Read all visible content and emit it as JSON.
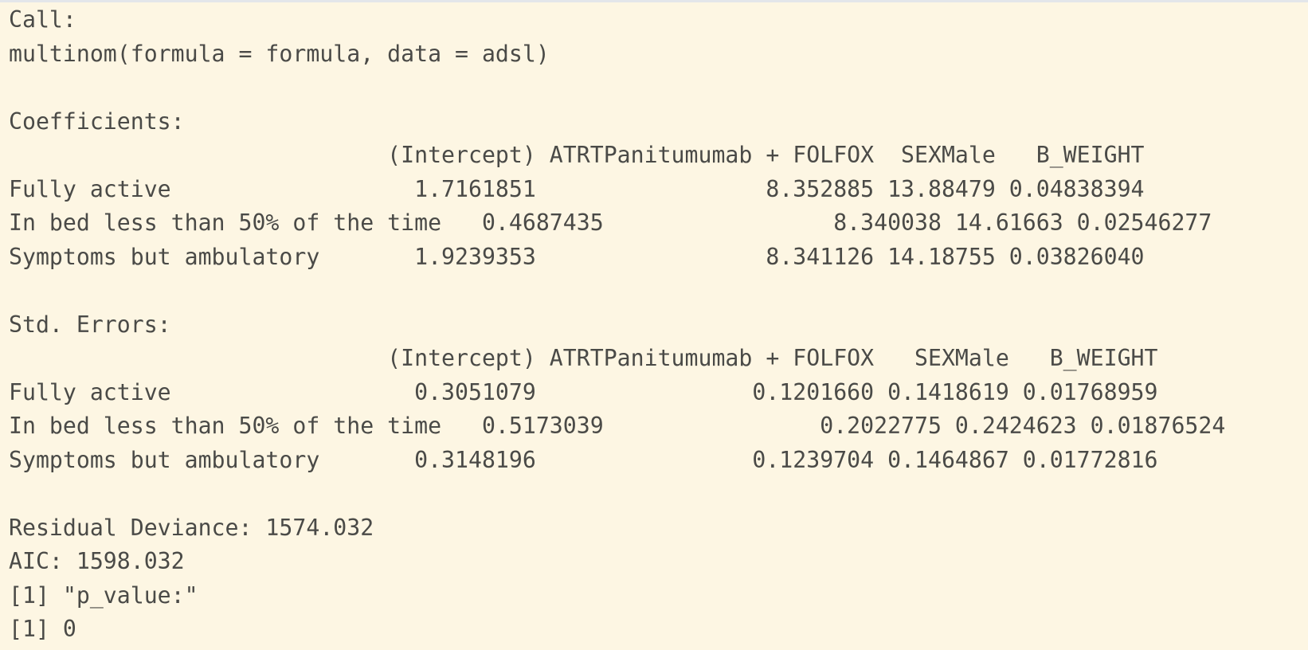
{
  "console": {
    "lines": [
      "Call:",
      "multinom(formula = formula, data = adsl)",
      "",
      "Coefficients:",
      "                            (Intercept) ATRTPanitumumab + FOLFOX  SEXMale   B_WEIGHT",
      "Fully active                  1.7161851                 8.352885 13.88479 0.04838394",
      "In bed less than 50% of the time   0.4687435                 8.340038 14.61663 0.02546277",
      "Symptoms but ambulatory       1.9239353                 8.341126 14.18755 0.03826040",
      "",
      "Std. Errors:",
      "                            (Intercept) ATRTPanitumumab + FOLFOX   SEXMale   B_WEIGHT",
      "Fully active                  0.3051079                0.1201660 0.1418619 0.01768959",
      "In bed less than 50% of the time   0.5173039                0.2022775 0.2424623 0.01876524",
      "Symptoms but ambulatory       0.3148196                0.1239704 0.1464867 0.01772816",
      "",
      "Residual Deviance: 1574.032",
      "AIC: 1598.032",
      "[1] \"p_value:\"",
      "[1] 0"
    ]
  }
}
